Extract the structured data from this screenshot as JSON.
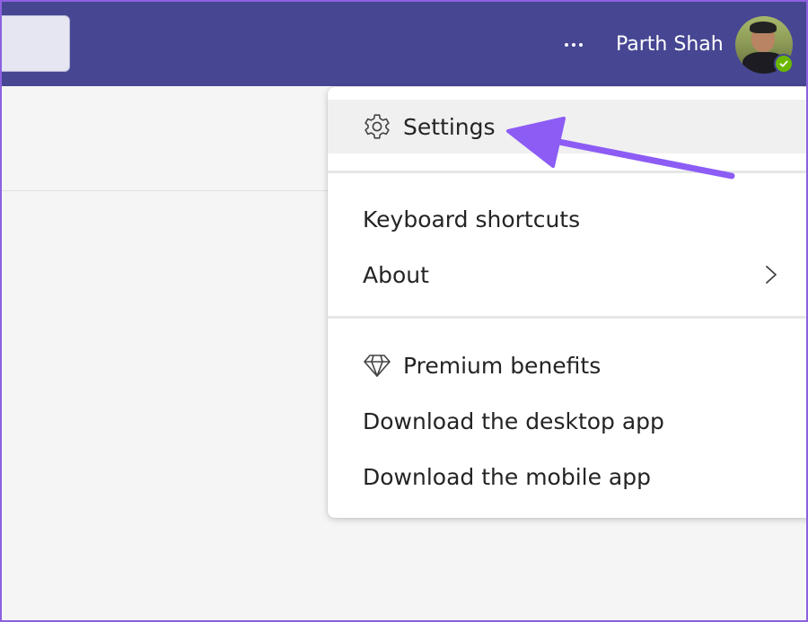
{
  "topbar": {
    "user_name": "Parth Shah",
    "more_icon": "more-horizontal-icon",
    "status": "available",
    "colors": {
      "background": "#464693",
      "status": "#6bb700"
    }
  },
  "menu": {
    "settings": {
      "label": "Settings",
      "icon": "gear-icon",
      "selected": true
    },
    "keyboard_shortcuts": {
      "label": "Keyboard shortcuts"
    },
    "about": {
      "label": "About",
      "icon": "chevron-right-icon"
    },
    "premium_benefits": {
      "label": "Premium benefits",
      "icon": "diamond-icon"
    },
    "download_desktop": {
      "label": "Download the desktop app"
    },
    "download_mobile": {
      "label": "Download the mobile app"
    }
  },
  "annotation": {
    "color": "#8c5cf5",
    "icon": "arrow-annotation"
  }
}
